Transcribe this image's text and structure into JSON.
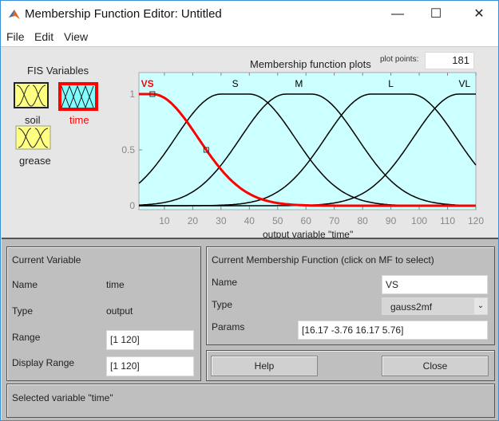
{
  "window": {
    "title": "Membership Function Editor: Untitled",
    "icon": "matlab-icon",
    "controls": [
      "minimize-icon",
      "maximize-icon",
      "close-icon"
    ]
  },
  "menu": [
    "File",
    "Edit",
    "View"
  ],
  "fis": {
    "heading": "FIS Variables",
    "variables": [
      {
        "name": "soil",
        "kind": "input",
        "selected": false
      },
      {
        "name": "time",
        "kind": "output",
        "selected": true
      },
      {
        "name": "grease",
        "kind": "input",
        "selected": false
      }
    ]
  },
  "plot": {
    "title": "Membership function plots",
    "plot_points_label": "plot points:",
    "plot_points": "181",
    "xlabel": "output variable \"time\""
  },
  "chart_data": {
    "type": "line",
    "title": "Membership function plots",
    "xlabel": "output variable \"time\"",
    "xlim": [
      1,
      120
    ],
    "ylim": [
      0,
      1
    ],
    "xticks": [
      "10",
      "20",
      "30",
      "40",
      "50",
      "60",
      "70",
      "80",
      "90",
      "100",
      "110",
      "120"
    ],
    "yticks": [
      "0",
      "0.5",
      "1"
    ],
    "background": "#ccffff",
    "selected_color": "#ff0000",
    "series": [
      {
        "name": "VS",
        "type": "gauss2mf",
        "params": [
          16.17,
          -3.76,
          16.17,
          5.76
        ],
        "selected": true
      },
      {
        "name": "S",
        "type": "gauss2mf",
        "params": [
          16.17,
          30,
          16.17,
          40
        ],
        "selected": false
      },
      {
        "name": "M",
        "type": "gauss2mf",
        "params": [
          16.17,
          53,
          16.17,
          62
        ],
        "selected": false
      },
      {
        "name": "L",
        "type": "gauss2mf",
        "params": [
          16.17,
          83,
          16.17,
          97
        ],
        "selected": false
      },
      {
        "name": "VL",
        "type": "gauss2mf",
        "params": [
          16.17,
          114,
          16.17,
          125
        ],
        "selected": false
      }
    ]
  },
  "current_variable": {
    "heading": "Current Variable",
    "name_label": "Name",
    "name": "time",
    "type_label": "Type",
    "type": "output",
    "range_label": "Range",
    "range": "[1 120]",
    "display_range_label": "Display Range",
    "display_range": "[1 120]"
  },
  "current_mf": {
    "heading": "Current Membership Function (click on MF to select)",
    "name_label": "Name",
    "name": "VS",
    "type_label": "Type",
    "type": "gauss2mf",
    "params_label": "Params",
    "params": "[16.17 -3.76 16.17 5.76]"
  },
  "buttons": {
    "help": "Help",
    "close": "Close"
  },
  "status": "Selected variable \"time\""
}
